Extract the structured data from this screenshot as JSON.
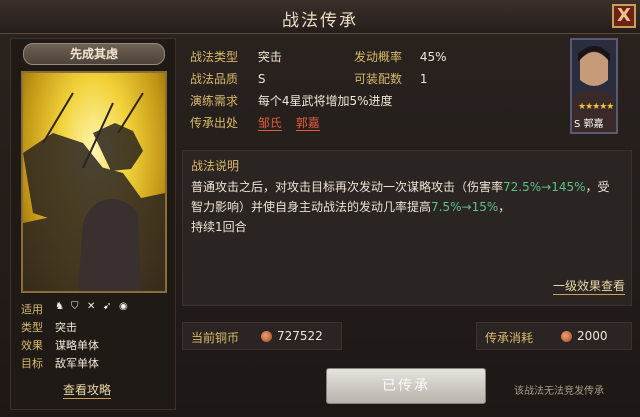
{
  "window": {
    "title": "战法传承",
    "close_label": "X"
  },
  "skill_card": {
    "name": "先成其虑",
    "attributes": [
      {
        "key": "适用",
        "value": ""
      },
      {
        "key": "类型",
        "value": "突击"
      },
      {
        "key": "效果",
        "value": "谋略单体"
      },
      {
        "key": "目标",
        "value": "敌军单体"
      }
    ],
    "applies_icons": [
      "cavalry-icon",
      "shield-icon",
      "crossed-swords-icon",
      "spear-icon",
      "shield-round-icon"
    ],
    "view_guide_label": "查看攻略"
  },
  "info": {
    "type_key": "战法类型",
    "type_value": "突击",
    "chance_key": "发动概率",
    "chance_value": "45%",
    "quality_key": "战法品质",
    "quality_value": "S",
    "equip_key": "可装配数",
    "equip_value": "1",
    "drill_key": "演练需求",
    "drill_value": "每个4星武将增加5%进度",
    "source_key": "传承出处",
    "source_values": [
      "邹氏",
      "郭嘉"
    ]
  },
  "general": {
    "name": "S 郭嘉",
    "stars": "★★★★★"
  },
  "description": {
    "title": "战法说明",
    "line1": "普通攻击之后，对攻击目标再次发动一次谋略攻击（伤害率",
    "dmg_from": "72.5%",
    "arrow": "→",
    "dmg_to": "145%",
    "line2": "，受智力影响）并使自身主动战法的发动几率提高",
    "chance_from": "7.5%",
    "chance_to": "15%",
    "line3": "，",
    "line4": "持续1回合",
    "level_link": "一级效果查看"
  },
  "currency": {
    "copper_label": "当前铜币",
    "copper_value": "727522",
    "cost_label": "传承消耗",
    "cost_value": "2000"
  },
  "action": {
    "button_label": "已传承",
    "hint": "该战法无法竞发传承"
  }
}
